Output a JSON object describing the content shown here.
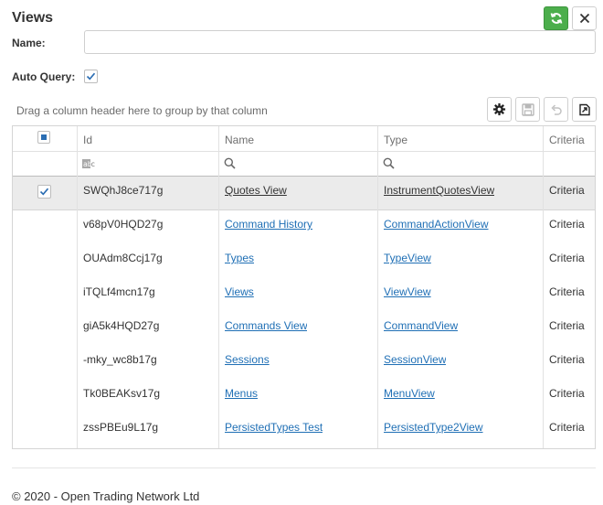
{
  "window": {
    "title": "Views"
  },
  "form": {
    "name_label": "Name:",
    "name_value": "",
    "auto_query_label": "Auto Query:",
    "auto_query_checked": true
  },
  "toolbar": {
    "group_hint": "Drag a column header here to group by that column",
    "icons": [
      "gear-icon",
      "save-icon",
      "undo-icon",
      "export-icon"
    ]
  },
  "grid": {
    "columns": [
      "Id",
      "Name",
      "Type",
      "Criteria"
    ],
    "filter_icons": [
      "abc-filter-icon",
      "search-icon",
      "search-icon"
    ],
    "rows": [
      {
        "id": "SWQhJ8ce717g",
        "name": "Quotes View",
        "type": "InstrumentQuotesView",
        "criteria": "Criteria",
        "selected": true
      },
      {
        "id": "v68pV0HQD27g",
        "name": "Command History",
        "type": "CommandActionView",
        "criteria": "Criteria",
        "selected": false
      },
      {
        "id": "OUAdm8Ccj17g",
        "name": "Types",
        "type": "TypeView",
        "criteria": "Criteria",
        "selected": false
      },
      {
        "id": "iTQLf4mcn17g",
        "name": "Views",
        "type": "ViewView",
        "criteria": "Criteria",
        "selected": false
      },
      {
        "id": "giA5k4HQD27g",
        "name": "Commands View",
        "type": "CommandView",
        "criteria": "Criteria",
        "selected": false
      },
      {
        "id": "-mky_wc8b17g",
        "name": "Sessions",
        "type": "SessionView",
        "criteria": "Criteria",
        "selected": false
      },
      {
        "id": "Tk0BEAKsv17g",
        "name": "Menus",
        "type": "MenuView",
        "criteria": "Criteria",
        "selected": false
      },
      {
        "id": "zssPBEu9L17g",
        "name": "PersistedTypes Test",
        "type": "PersistedType2View",
        "criteria": "Criteria",
        "selected": false
      }
    ]
  },
  "colors": {
    "accent": "#4cae4c",
    "link": "#1f6fb5",
    "selected_row": "#ebebeb"
  },
  "footer": {
    "text": "© 2020 - Open Trading Network Ltd"
  }
}
